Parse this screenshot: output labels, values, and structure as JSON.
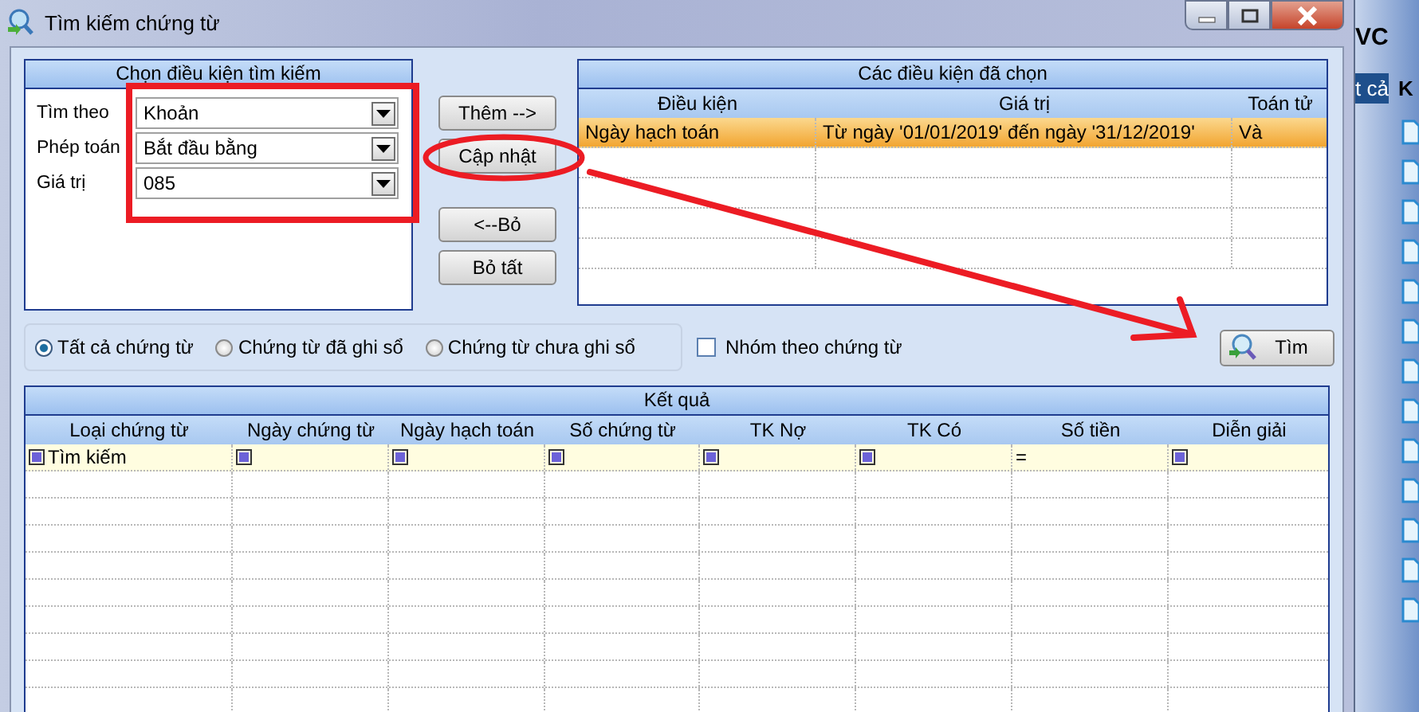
{
  "window": {
    "title": "Tìm kiếm chứng từ"
  },
  "criteria_panel": {
    "title": "Chọn điều kiện tìm kiếm",
    "fields": [
      {
        "label": "Tìm theo",
        "value": "Khoản"
      },
      {
        "label": "Phép toán",
        "value": "Bắt đầu bằng"
      },
      {
        "label": "Giá trị",
        "value": "085"
      }
    ]
  },
  "buttons": [
    "Thêm -->",
    "Cập nhật",
    "<--Bỏ",
    "Bỏ tất"
  ],
  "selected_conditions": {
    "title": "Các điều kiện đã chọn",
    "columns": [
      "Điều kiện",
      "Giá trị",
      "Toán tử"
    ],
    "rows": [
      {
        "cells": [
          "Ngày hạch toán",
          "Từ ngày '01/01/2019' đến ngày '31/12/2019'",
          "Và"
        ],
        "selected": true
      }
    ]
  },
  "filter_options": [
    {
      "label": "Tất cả chứng từ",
      "selected": true
    },
    {
      "label": "Chứng từ đã ghi sổ",
      "selected": false
    },
    {
      "label": "Chứng từ chưa ghi sổ",
      "selected": false
    }
  ],
  "group_by_voucher": {
    "label": "Nhóm theo chứng từ",
    "checked": false
  },
  "search_button": "Tìm",
  "results": {
    "title": "Kết quả",
    "columns": [
      "Loại chứng từ",
      "Ngày chứng từ",
      "Ngày hạch toán",
      "Số chứng từ",
      "TK Nợ",
      "TK Có",
      "Số tiền",
      "Diễn giải"
    ],
    "filter_row": [
      {
        "kind": "checkbox",
        "text": "Tìm kiếm"
      },
      {
        "kind": "checkbox"
      },
      {
        "kind": "checkbox"
      },
      {
        "kind": "checkbox"
      },
      {
        "kind": "checkbox"
      },
      {
        "kind": "checkbox"
      },
      {
        "kind": "equals",
        "text": "="
      },
      {
        "kind": "checkbox"
      }
    ]
  },
  "background_app": {
    "title_fragment": "VC",
    "tab_fragment": "t cả",
    "panel_fragment": "K"
  }
}
